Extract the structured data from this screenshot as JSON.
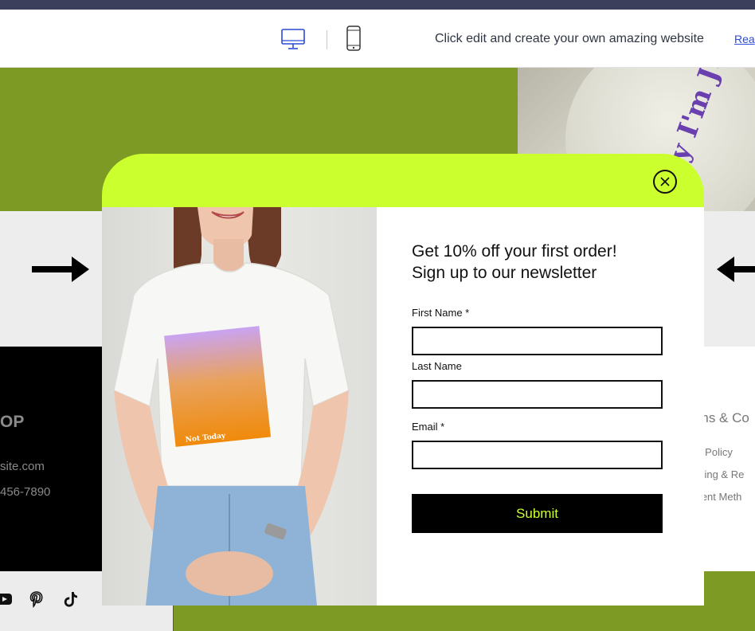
{
  "editor_bar": {
    "message": "Click edit and create your own amazing website",
    "link": "Rea"
  },
  "background_site": {
    "hero_shirt_text": "Lazy I'm Just",
    "footer_title": "OP",
    "footer_email": "site.com",
    "footer_phone": "456-7890",
    "footer_terms_title": "rms & Co",
    "footer_links": [
      "re Policy",
      "pping & Re",
      "ment Meth"
    ],
    "social_icons": [
      "youtube-icon",
      "pinterest-icon",
      "tiktok-icon"
    ]
  },
  "popup": {
    "heading_line1": "Get 10% off your first order!",
    "heading_line2": "Sign up to our newsletter",
    "fields": {
      "first_name_label": "First Name *",
      "last_name_label": "Last Name",
      "email_label": "Email *"
    },
    "submit_label": "Submit",
    "image_print_text": "Not Today"
  },
  "colors": {
    "accent_lime": "#cbff2d",
    "olive": "#7d9a25",
    "black": "#000000"
  }
}
